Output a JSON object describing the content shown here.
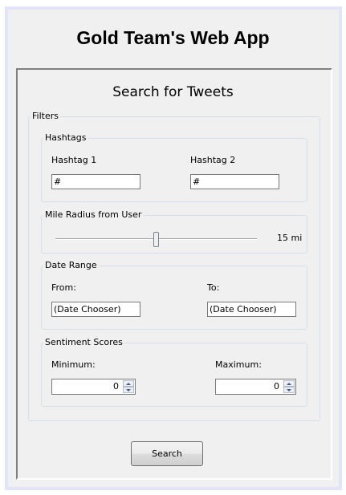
{
  "app_title": "Gold Team's Web App",
  "form_title": "Search for Tweets",
  "filters": {
    "legend": "Filters",
    "hashtags": {
      "legend": "Hashtags",
      "hashtag1_label": "Hashtag 1",
      "hashtag1_value": "#",
      "hashtag2_label": "Hashtag 2",
      "hashtag2_value": "#"
    },
    "radius": {
      "legend": "Mile Radius from User",
      "value_label": "15 mi",
      "slider_fraction": 0.5
    },
    "date_range": {
      "legend": "Date Range",
      "from_label": "From:",
      "from_value": "(Date Chooser)",
      "to_label": "To:",
      "to_value": "(Date Chooser)"
    },
    "sentiment": {
      "legend": "Sentiment Scores",
      "min_label": "Minimum:",
      "min_value": "0",
      "max_label": "Maximum:",
      "max_value": "0"
    }
  },
  "search_button": "Search",
  "colors": {
    "frame": "#e3e3fa",
    "window": "#f0f0f0"
  }
}
